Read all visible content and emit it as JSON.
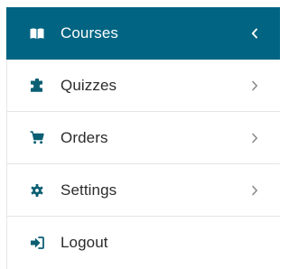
{
  "menu": {
    "items": [
      {
        "label": "Courses",
        "icon": "book-open-icon",
        "active": true,
        "chevron": "left"
      },
      {
        "label": "Quizzes",
        "icon": "puzzle-icon",
        "active": false,
        "chevron": "right"
      },
      {
        "label": "Orders",
        "icon": "cart-icon",
        "active": false,
        "chevron": "right"
      },
      {
        "label": "Settings",
        "icon": "gear-icon",
        "active": false,
        "chevron": "right"
      },
      {
        "label": "Logout",
        "icon": "logout-icon",
        "active": false,
        "chevron": null
      }
    ]
  },
  "colors": {
    "active_bg": "#006482",
    "active_text": "#ffffff",
    "text": "#2b2b2b",
    "icon": "#0b5f73",
    "chevron": "#8a8a8a"
  }
}
